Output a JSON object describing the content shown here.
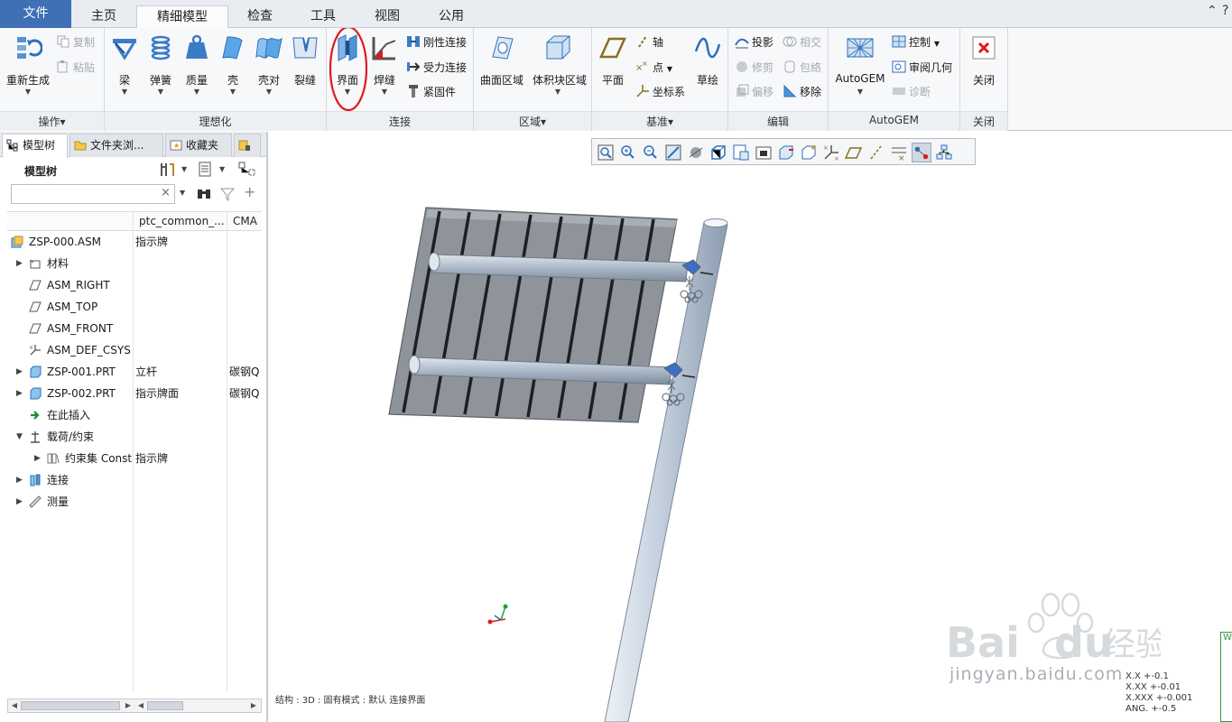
{
  "menu": {
    "tabs": [
      "文件",
      "主页",
      "精细模型",
      "检查",
      "工具",
      "视图",
      "公用"
    ],
    "active": "精细模型"
  },
  "ribbon": {
    "groups": {
      "operations": "操作▾",
      "idealize": "理想化",
      "connect": "连接",
      "region": "区域▾",
      "datum": "基准▾",
      "edit": "编辑",
      "autogem": "AutoGEM",
      "close": "关闭"
    },
    "regenerate": "重新生成",
    "copy": "复制",
    "paste": "粘贴",
    "beam": "梁",
    "spring": "弹簧",
    "mass": "质量",
    "shell": "壳",
    "shell_pair": "壳对",
    "crack": "裂缝",
    "interface": "界面",
    "weld": "焊缝",
    "rigid_link": "刚性连接",
    "weighted_link": "受力连接",
    "fastener": "紧固件",
    "surface_region": "曲面区域",
    "volume_region": "体积块区域",
    "plane": "平面",
    "axis": "轴",
    "point": "点",
    "csys": "坐标系",
    "sketch": "草绘",
    "project": "投影",
    "intersect": "相交",
    "trim": "修剪",
    "wrap": "包络",
    "offset": "偏移",
    "remove": "移除",
    "autogem_btn": "AutoGEM",
    "control": "控制",
    "review_geometry": "审阅几何",
    "diagnose": "诊断",
    "close_btn": "关闭"
  },
  "panel": {
    "tabs": [
      "模型树",
      "文件夹浏...",
      "收藏夹"
    ],
    "title": "模型树",
    "search_value": "",
    "columns": [
      "ptc_common_...",
      "CMA"
    ],
    "rows": [
      {
        "name": "ZSP-000.ASM",
        "c2": "指示牌",
        "c3": ""
      },
      {
        "name": "材料",
        "c2": "",
        "c3": ""
      },
      {
        "name": "ASM_RIGHT",
        "c2": "",
        "c3": ""
      },
      {
        "name": "ASM_TOP",
        "c2": "",
        "c3": ""
      },
      {
        "name": "ASM_FRONT",
        "c2": "",
        "c3": ""
      },
      {
        "name": "ASM_DEF_CSYS",
        "c2": "",
        "c3": ""
      },
      {
        "name": "ZSP-001.PRT",
        "c2": "立杆",
        "c3": "碳钢Q"
      },
      {
        "name": "ZSP-002.PRT",
        "c2": "指示牌面",
        "c3": "碳钢Q"
      },
      {
        "name": "在此插入",
        "c2": "",
        "c3": ""
      },
      {
        "name": "载荷/约束",
        "c2": "",
        "c3": ""
      },
      {
        "name": "约束集 Const",
        "c2": "指示牌",
        "c3": ""
      },
      {
        "name": "连接",
        "c2": "",
        "c3": ""
      },
      {
        "name": "测量",
        "c2": "",
        "c3": ""
      }
    ]
  },
  "graphics": {
    "status": "结构 : 3D : 固有模式 : 默认 连接界面",
    "tolerances": [
      "X.X +-0.1",
      "X.XX +-0.01",
      "X.XXX +-0.001",
      "ANG. +-0.5"
    ],
    "watermark": "jingyan.baidu.com",
    "green_label": "W"
  },
  "colors": {
    "accent": "#3f70b5",
    "highlight_circle": "#e0191c",
    "panel_face": "#8f949b",
    "pole": "#c4d0de"
  }
}
